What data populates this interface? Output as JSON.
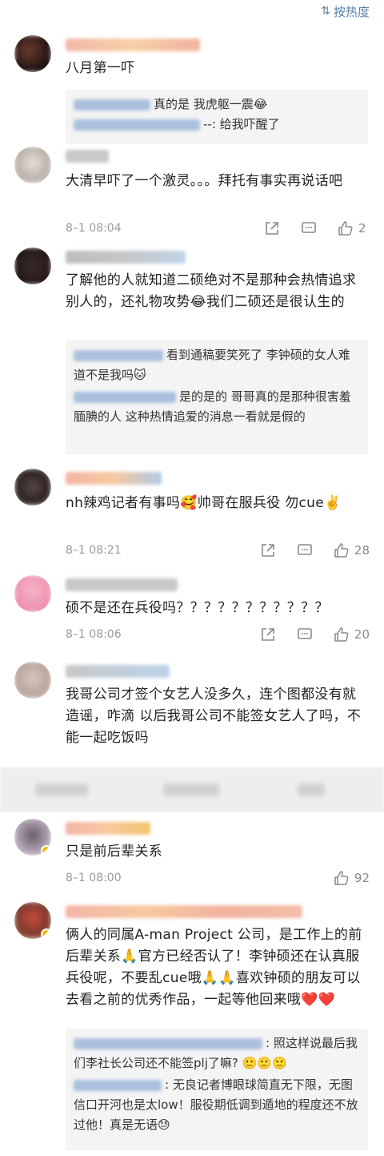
{
  "sort": {
    "icon": "sort-icon",
    "label": "按热度"
  },
  "colors": {
    "link": "#5b7ea8",
    "meta": "#999999",
    "reply_bg": "#f4f4f4",
    "badge": "#f5b800"
  },
  "comments": [
    {
      "text": "八月第一吓",
      "replies": [
        {
          "text": "真的是 我虎躯一震😂"
        },
        {
          "text": "--: 给我吓醒了"
        }
      ]
    },
    {
      "text": "大清早吓了一个激灵。。。拜托有事实再说话吧",
      "time": "8–1 08:04",
      "likes": "2"
    },
    {
      "text": "了解他的人就知道二硕绝对不是那种会热情追求别人的，还礼物攻势😂我们二硕还是很认生的",
      "replies": [
        {
          "text": "看到通稿要笑死了 李钟硕的女人难道不是我吗🐱"
        },
        {
          "text": "是的是的  哥哥真的是那种很害羞腼腆的人 这种热情追爱的消息一看就是假的"
        }
      ]
    },
    {
      "text": "nh辣鸡记者有事吗🥰帅哥在服兵役 勿cue✌️",
      "time": "8–1 08:21",
      "likes": "28"
    },
    {
      "text": "硕不是还在兵役吗？？？？？？？？？？？",
      "time": "8–1 08:06",
      "likes": "20"
    },
    {
      "text": "我哥公司才签个女艺人没多久，连个图都没有就造谣，咋滴 以后我哥公司不能签女艺人了吗，不能一起吃饭吗"
    },
    {
      "text": "只是前后辈关系",
      "time": "8–1 08:00",
      "likes": "92"
    },
    {
      "text": "俩人的同属A-man Project 公司，是工作上的前后辈关系🙏官方已经否认了！李钟硕还在认真服兵役呢，不要乱cue哦🙏🙏喜欢钟硕的朋友可以去看之前的优秀作品，一起等他回来哦❤️❤️",
      "replies": [
        {
          "text": ": 照这样说最后我们李社长公司还不能签plj了嘛? 🙂🙂🙂"
        },
        {
          "text": ": 无良记者博眼球简直无下限，无图信口开河也是太low！服役期低调到遁地的程度还不放过他！真是无语😓"
        }
      ]
    }
  ]
}
